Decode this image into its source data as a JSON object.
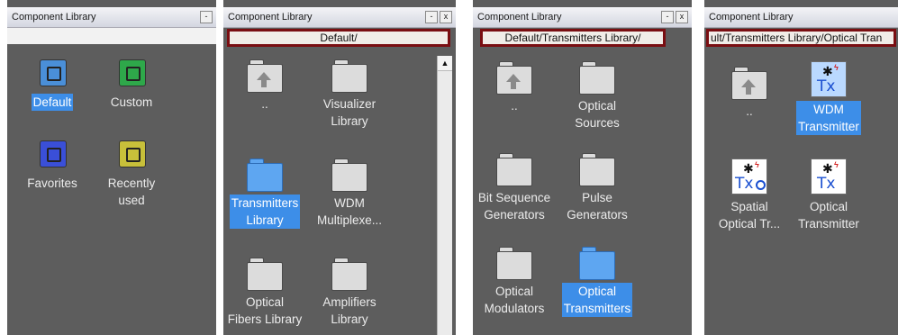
{
  "colors": {
    "panel_bg": "#5d5d5d",
    "selection": "#3d8ee8",
    "path_border": "#7a0e12",
    "tx_blue": "#1a4fd0"
  },
  "panels": [
    {
      "title": "Component Library",
      "buttons": [
        "-"
      ],
      "items": [
        {
          "label": "Default",
          "icon": "library-icon",
          "color": "#4a8fd8",
          "selected": true
        },
        {
          "label": "Custom",
          "icon": "library-icon",
          "color": "#2ea84a",
          "selected": false
        },
        {
          "label": "Favorites",
          "icon": "library-icon",
          "color": "#3a4fd8",
          "selected": false
        },
        {
          "label": "Recently\nused",
          "icon": "library-icon",
          "color": "#c8c03a",
          "selected": false
        }
      ]
    },
    {
      "title": "Component Library",
      "buttons": [
        "-",
        "x"
      ],
      "path": "Default/",
      "scroll_up": "▲",
      "items": [
        {
          "label": "..",
          "icon": "up-folder-icon",
          "selected": false
        },
        {
          "label": "Visualizer\nLibrary",
          "icon": "folder-icon",
          "selected": false
        },
        {
          "label": "Transmitters\nLibrary",
          "icon": "folder-icon",
          "selected": true
        },
        {
          "label": "WDM\nMultiplexe...",
          "icon": "folder-icon",
          "selected": false
        },
        {
          "label": "Optical\nFibers Library",
          "icon": "folder-icon",
          "selected": false
        },
        {
          "label": "Amplifiers\nLibrary",
          "icon": "folder-icon",
          "selected": false
        }
      ]
    },
    {
      "title": "Component Library",
      "buttons": [
        "-",
        "x"
      ],
      "path": "Default/Transmitters Library/",
      "items": [
        {
          "label": "..",
          "icon": "up-folder-icon",
          "selected": false
        },
        {
          "label": "Optical\nSources",
          "icon": "folder-icon",
          "selected": false
        },
        {
          "label": "Bit Sequence\nGenerators",
          "icon": "folder-icon",
          "selected": false
        },
        {
          "label": "Pulse\nGenerators",
          "icon": "folder-icon",
          "selected": false
        },
        {
          "label": "Optical\nModulators",
          "icon": "folder-icon",
          "selected": false
        },
        {
          "label": "Optical\nTransmitters",
          "icon": "folder-icon",
          "selected": true
        }
      ]
    },
    {
      "title": "Component Library",
      "path": "ult/Transmitters Library/Optical Tran",
      "items": [
        {
          "label": "..",
          "icon": "up-folder-icon",
          "selected": false
        },
        {
          "label": "WDM\nTransmitter",
          "icon": "transmitter-icon",
          "glyph": "Tx",
          "selected": true
        },
        {
          "label": "Spatial\nOptical Tr...",
          "icon": "spatial-transmitter-icon",
          "glyph": "Tx",
          "selected": false
        },
        {
          "label": "Optical\nTransmitter",
          "icon": "transmitter-icon",
          "glyph": "Tx",
          "selected": false
        }
      ]
    }
  ]
}
